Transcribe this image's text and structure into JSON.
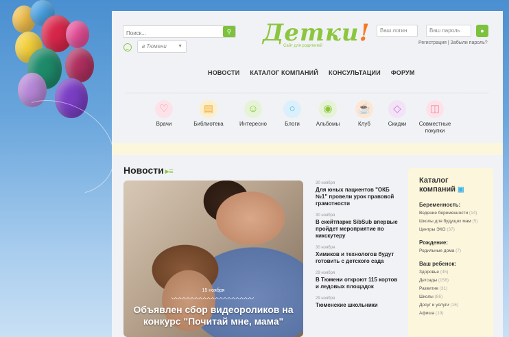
{
  "header": {
    "search_placeholder": "Поиск...",
    "city": "в Тюмени",
    "logo": "Детки",
    "logo_mark": "!",
    "logo_tagline": "Сайт для родителей",
    "login_placeholder": "Ваш логин",
    "password_placeholder": "Ваш пароль",
    "register_links": "Регистрация | Забыли пароль?"
  },
  "nav": {
    "items": [
      "НОВОСТИ",
      "КАТАЛОГ КОМПАНИЙ",
      "КОНСУЛЬТАЦИИ",
      "ФОРУМ"
    ]
  },
  "categories": [
    {
      "label": "Врачи",
      "icon": "heart-icon",
      "color": "#f38aa3"
    },
    {
      "label": "Библиотека",
      "icon": "book-icon",
      "color": "#f2b13c"
    },
    {
      "label": "Интересно",
      "icon": "smile-icon",
      "color": "#8cc63f"
    },
    {
      "label": "Блоги",
      "icon": "chat-icon",
      "color": "#3db4e5"
    },
    {
      "label": "Альбомы",
      "icon": "camera-icon",
      "color": "#8cc63f"
    },
    {
      "label": "Клуб",
      "icon": "cup-icon",
      "color": "#f47a20"
    },
    {
      "label": "Скидки",
      "icon": "tag-icon",
      "color": "#c57dd4"
    },
    {
      "label": "Совместные покупки",
      "icon": "bag-icon",
      "color": "#f38aa3"
    }
  ],
  "news": {
    "title": "Новости",
    "feature": {
      "date": "15 ноября",
      "text": "Объявлен сбор видеороликов на конкурс \"Почитай мне, мама\""
    },
    "items": [
      {
        "date": "30 ноября",
        "title": "Для юных пациентов \"ОКБ №1\" провели урок правовой грамотности"
      },
      {
        "date": "30 ноября",
        "title": "В скейтпарке SibSub впервые пройдет мероприятие по кикскутеру"
      },
      {
        "date": "30 ноября",
        "title": "Химиков и технологов будут готовить с детского сада"
      },
      {
        "date": "29 ноября",
        "title": "В Тюмени откроют 115 кортов и ледовых площадок"
      },
      {
        "date": "29 ноября",
        "title": "Тюменские школьники"
      }
    ]
  },
  "catalog": {
    "title": "Каталог компаний",
    "groups": [
      {
        "title": "Беременность:",
        "links": [
          {
            "name": "Ведение беременности",
            "count": "(14)"
          },
          {
            "name": "Школы для будущих мам",
            "count": "(5)"
          },
          {
            "name": "Центры ЭКО",
            "count": "(37)"
          }
        ]
      },
      {
        "title": "Рождение:",
        "links": [
          {
            "name": "Родильные дома",
            "count": "(7)"
          }
        ]
      },
      {
        "title": "Ваш ребенок:",
        "links": [
          {
            "name": "Здоровье",
            "count": "(45)"
          },
          {
            "name": "Детсады",
            "count": "(158)"
          },
          {
            "name": "Развитие",
            "count": "(31)"
          },
          {
            "name": "Школы",
            "count": "(86)"
          },
          {
            "name": "Досуг и услуги",
            "count": "(16)"
          },
          {
            "name": "Афиша",
            "count": "(19)"
          }
        ]
      }
    ]
  },
  "colors": {
    "brand_green": "#8cc63f",
    "brand_orange": "#f47a20",
    "catalog_bg": "#fbf6dc"
  }
}
